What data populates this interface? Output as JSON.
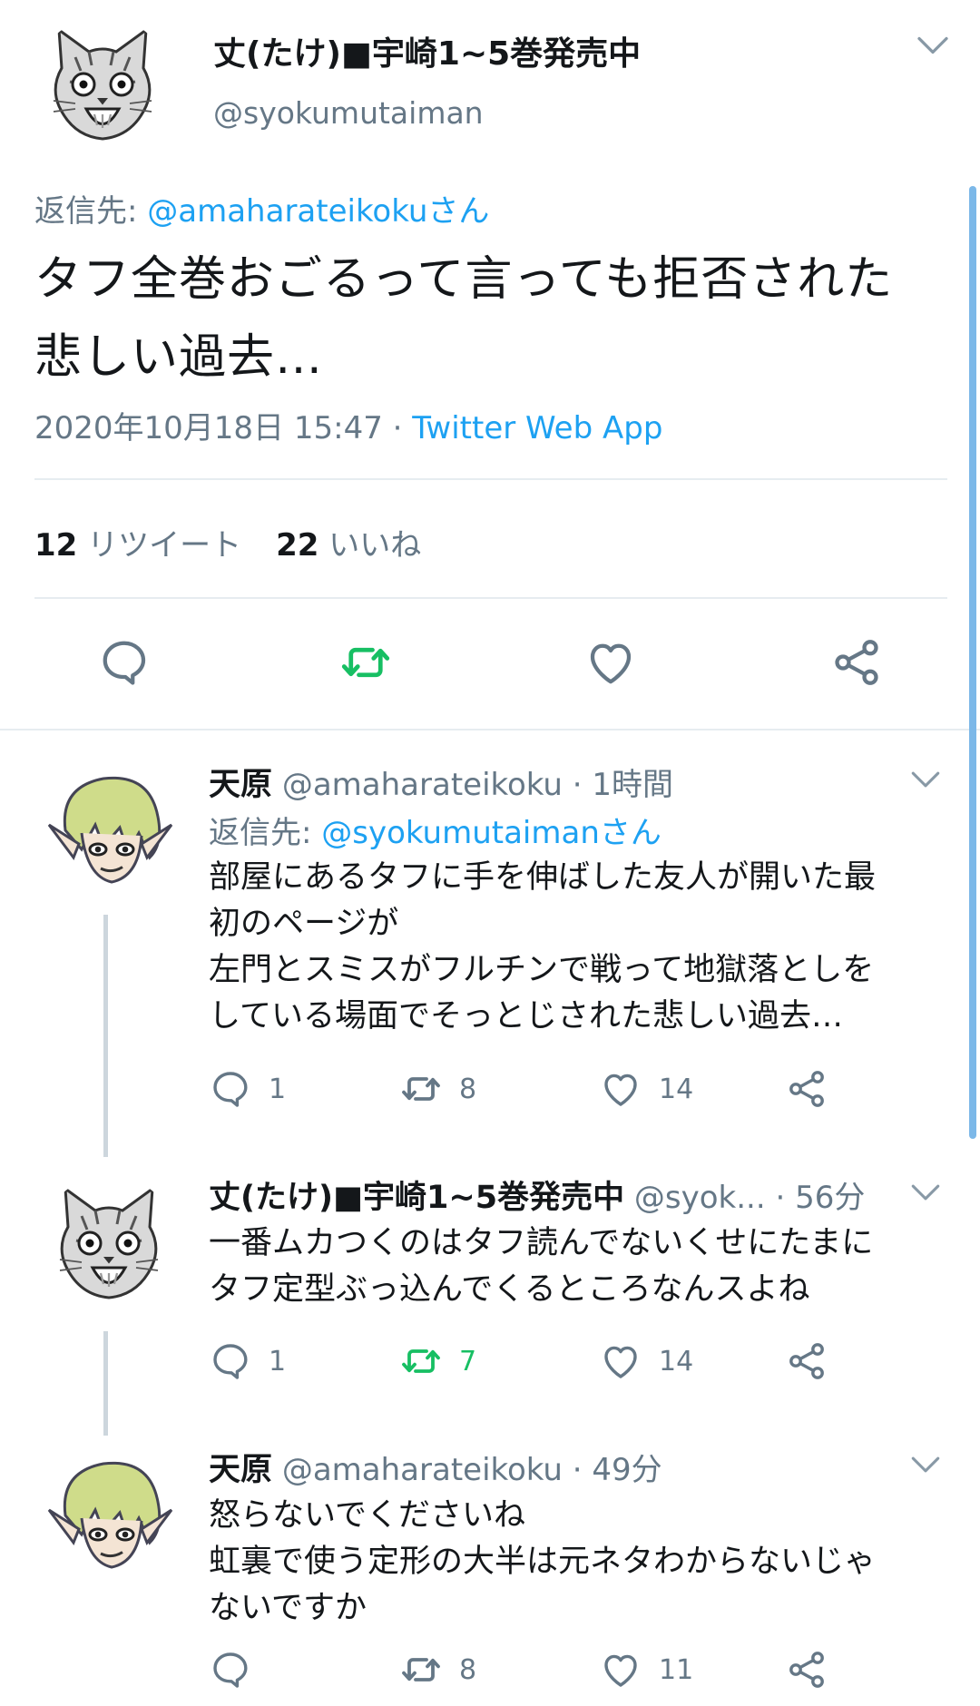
{
  "main_tweet": {
    "author_name": "丈(たけ)■宇崎1~5巻発売中",
    "author_handle": "@syokumutaiman",
    "reply_prefix": "返信先: ",
    "reply_to": "@amaharateikokuさん",
    "text_line1": "タフ全巻おごるって言っても拒否された",
    "text_line2": "悲しい過去…",
    "timestamp": "2020年10月18日 15:47 · ",
    "source": "Twitter Web App",
    "retweet_count": "12",
    "retweet_label": "リツイート",
    "like_count": "22",
    "like_label": "いいね"
  },
  "replies": [
    {
      "name": "天原",
      "handle": "@amaharateikoku",
      "time": " · 1時間",
      "reply_prefix": "返信先: ",
      "reply_to": "@syokumutaimanさん",
      "lines": [
        "部屋にあるタフに手を伸ばした友人が開いた最",
        "初のページが",
        "左門とスミスがフルチンで戦って地獄落としを",
        "している場面でそっとじされた悲しい過去…"
      ],
      "replies": "1",
      "retweets": "8",
      "likes": "14"
    },
    {
      "name": "丈(たけ)■宇崎1~5巻発売中",
      "handle": "@syok...",
      "time": " · 56分",
      "lines": [
        "一番ムカつくのはタフ読んでないくせにたまに",
        "タフ定型ぶっ込んでくるところなんスよね"
      ],
      "replies": "1",
      "retweets": "7",
      "likes": "14"
    },
    {
      "name": "天原",
      "handle": "@amaharateikoku",
      "time": " · 49分",
      "lines": [
        "怒らないでくださいね",
        "虹裏で使う定形の大半は元ネタわからないじゃ",
        "ないですか"
      ],
      "replies": "",
      "retweets": "8",
      "likes": "11"
    }
  ],
  "colors": {
    "link": "#1da1f2",
    "retweet_active": "#17bf63",
    "secondary_text": "#657786",
    "divider": "#e6ecf0"
  },
  "icons": [
    "reply-icon",
    "retweet-icon",
    "like-icon",
    "share-icon",
    "chevron-down-icon"
  ]
}
